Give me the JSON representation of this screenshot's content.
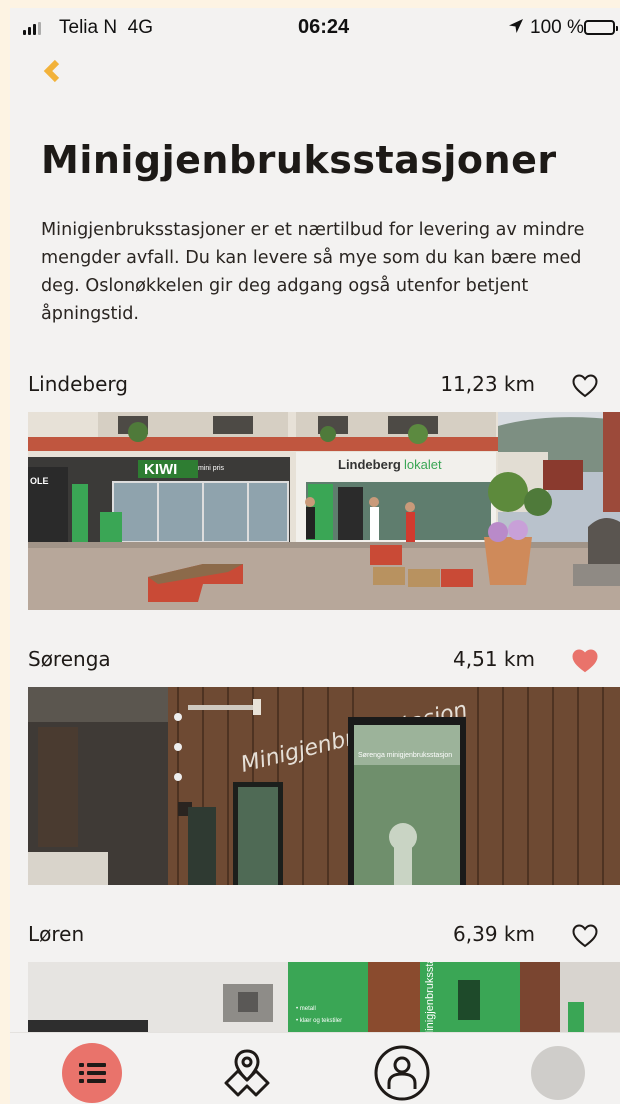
{
  "status_bar": {
    "carrier": "Telia N  4G",
    "time": "06:24",
    "battery": "100 %"
  },
  "page": {
    "title": "Minigjenbruksstasjoner",
    "intro": "Minigjenbruksstasjoner er et nærtilbud for levering av mindre mengder avfall. Du kan levere så mye som du kan bære med deg. Oslonøkkelen gir deg adgang også utenfor betjent åpningstid."
  },
  "stations": [
    {
      "name": "Lindeberg",
      "distance": "11,23 km",
      "favorite": false,
      "photo": {
        "store_sign": "KIWI",
        "store_sign_small": "mini pris",
        "building_sign_bold": "Lindeberg",
        "building_sign_light": "lokalet",
        "shop_sign": "OLE"
      }
    },
    {
      "name": "Sørenga",
      "distance": "4,51 km",
      "favorite": true,
      "photo": {
        "wall_lettering": "Minigjenbruksstasjon",
        "window_text": "Sørenga minigjenbruksstasjon"
      }
    },
    {
      "name": "Løren",
      "distance": "6,39 km",
      "favorite": false,
      "photo": {
        "green_sign": "Minigjenbruksstasjon",
        "panel_text_1": "• metall",
        "panel_text_2": "• klær og tekstiler"
      }
    }
  ],
  "tabbar": {
    "tabs": [
      {
        "icon": "list-icon",
        "active": true
      },
      {
        "icon": "map-icon",
        "active": false
      },
      {
        "icon": "profile-icon",
        "active": false
      },
      {
        "icon": "avatar",
        "active": false
      }
    ]
  },
  "colors": {
    "accent": "#e9736b",
    "back_arrow": "#f2b23a",
    "background": "#f3f2f1",
    "outer_border": "#fdf3e3",
    "text": "#1e1a17"
  }
}
